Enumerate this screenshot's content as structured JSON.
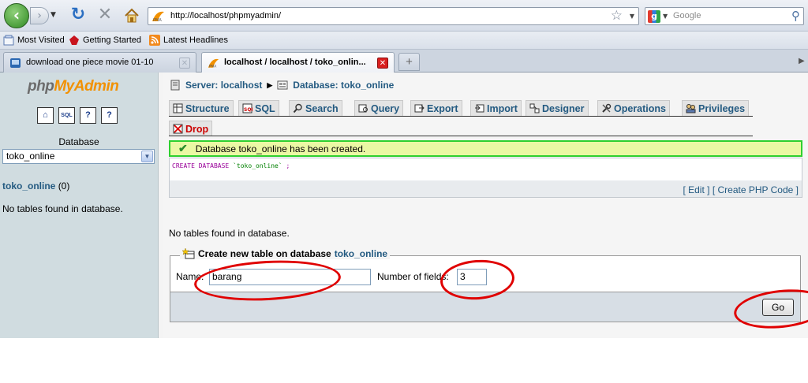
{
  "browser": {
    "url": "http://localhost/phpmyadmin/",
    "search_placeholder": "Google",
    "bookmarks": [
      {
        "label": "Most Visited"
      },
      {
        "label": "Getting Started"
      },
      {
        "label": "Latest Headlines"
      }
    ],
    "tabs": [
      {
        "label": "download one piece movie 01-10",
        "active": false
      },
      {
        "label": "localhost / localhost / toko_onlin...",
        "active": true
      }
    ]
  },
  "sidebar": {
    "logo_left": "php",
    "logo_right": "MyAdmin",
    "quick_icons": [
      "home-icon",
      "sql-query-icon",
      "docs-icon",
      "help-icon"
    ],
    "database_label": "Database",
    "database_selected": "toko_online",
    "db_link": "toko_online",
    "db_count": "(0)",
    "no_tables": "No tables found in database."
  },
  "breadcrumb": {
    "server": "Server: localhost",
    "database": "Database: toko_online"
  },
  "tabs": [
    {
      "label": "Structure",
      "icon": "structure-icon"
    },
    {
      "label": "SQL",
      "icon": "sql-icon"
    },
    {
      "label": "Search",
      "icon": "search-icon"
    },
    {
      "label": "Query",
      "icon": "query-icon"
    },
    {
      "label": "Export",
      "icon": "export-icon"
    },
    {
      "label": "Import",
      "icon": "import-icon"
    },
    {
      "label": "Designer",
      "icon": "designer-icon"
    },
    {
      "label": "Operations",
      "icon": "operations-icon"
    },
    {
      "label": "Privileges",
      "icon": "privileges-icon"
    }
  ],
  "drop_tab": "Drop",
  "message": {
    "success": "Database toko_online has been created.",
    "sql_kw1": "CREATE DATABASE",
    "sql_str": "`toko_online`",
    "sql_end": ";",
    "edit_link": "Edit",
    "php_link": "Create PHP Code"
  },
  "main": {
    "no_tables": "No tables found in database."
  },
  "create_table": {
    "legend_prefix": "Create new table on database",
    "legend_db": "toko_online",
    "name_label": "Name:",
    "name_value": "barang",
    "fields_label": "Number of fields:",
    "fields_value": "3",
    "go_label": "Go"
  },
  "colors": {
    "pma_link": "#235a81",
    "success_border": "#2fd02f",
    "success_bg": "#ebf8a4",
    "annotation_red": "#e00000"
  }
}
